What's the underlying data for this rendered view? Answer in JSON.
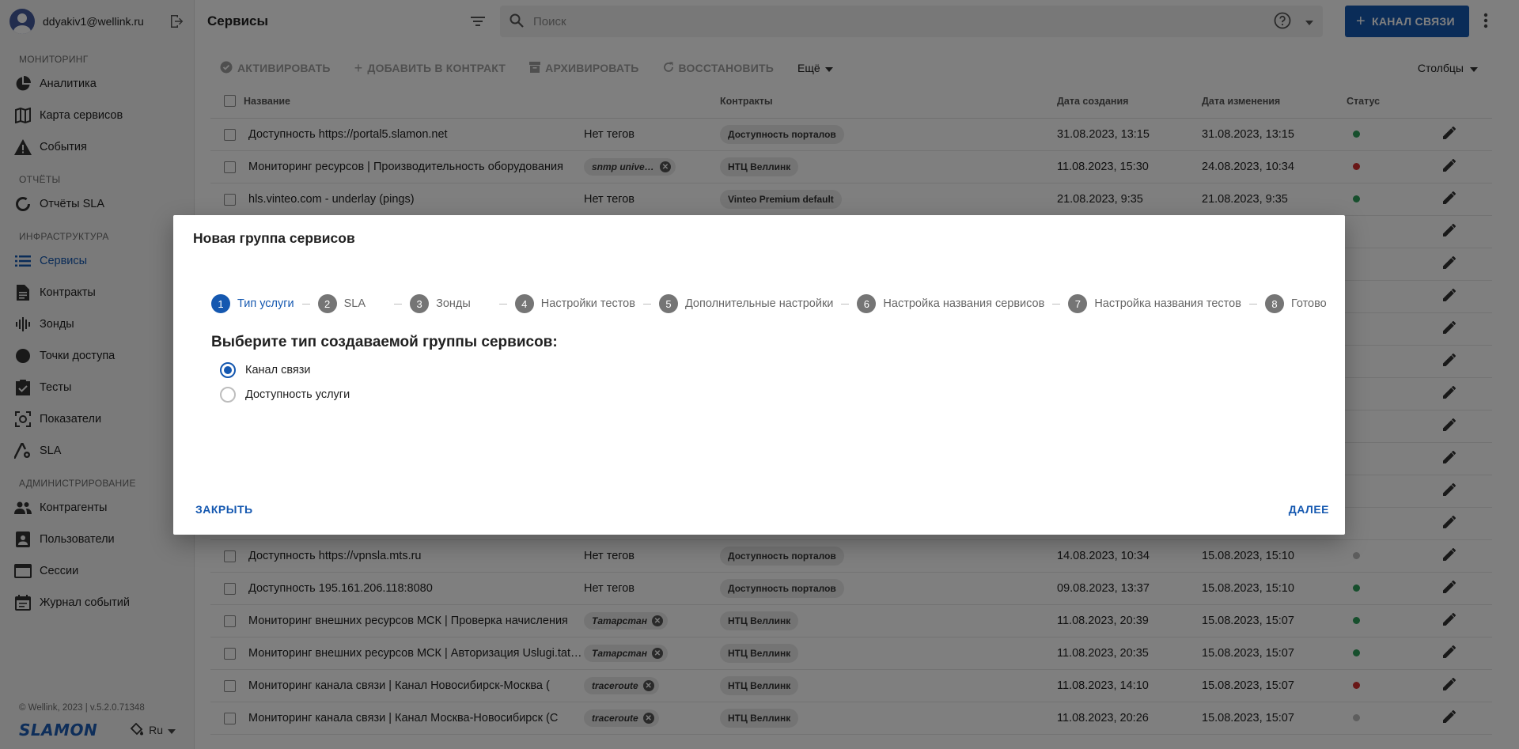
{
  "user": {
    "email": "ddyakiv1@wellink.ru"
  },
  "sidebar": {
    "sections": [
      {
        "title": "МОНИТОРИНГ",
        "items": [
          {
            "label": "Аналитика",
            "icon": "pie-chart-icon"
          },
          {
            "label": "Карта сервисов",
            "icon": "map-icon"
          },
          {
            "label": "События",
            "icon": "warning-icon"
          }
        ]
      },
      {
        "title": "ОТЧЁТЫ",
        "items": [
          {
            "label": "Отчёты SLA",
            "icon": "circle-report-icon"
          }
        ]
      },
      {
        "title": "ИНФРАСТРУКТУРА",
        "items": [
          {
            "label": "Сервисы",
            "icon": "list-icon"
          },
          {
            "label": "Контракты",
            "icon": "document-icon"
          },
          {
            "label": "Зонды",
            "icon": "probe-icon"
          },
          {
            "label": "Точки доступа",
            "icon": "dot-icon"
          },
          {
            "label": "Тесты",
            "icon": "checkbox-icon"
          },
          {
            "label": "Показатели",
            "icon": "metric-icon"
          },
          {
            "label": "SLA",
            "icon": "sla-icon"
          }
        ]
      },
      {
        "title": "АДМИНИСТРИРОВАНИЕ",
        "items": [
          {
            "label": "Контрагенты",
            "icon": "people-icon"
          },
          {
            "label": "Пользователи",
            "icon": "user-card-icon"
          },
          {
            "label": "Сессии",
            "icon": "window-icon"
          },
          {
            "label": "Журнал событий",
            "icon": "calendar-icon"
          }
        ]
      }
    ],
    "version": "© Wellink, 2023 | v.5.2.0.71348",
    "logo": "SLAMON",
    "language": "Ru"
  },
  "header": {
    "title": "Сервисы",
    "search_placeholder": "Поиск",
    "primary_button": "КАНАЛ СВЯЗИ"
  },
  "toolbar": {
    "activate": "АКТИВИРОВАТЬ",
    "add_to_contract": "ДОБАВИТЬ В КОНТРАКТ",
    "archive": "АРХИВИРОВАТЬ",
    "restore": "ВОССТАНОВИТЬ",
    "more": "Ещё",
    "columns": "Столбцы"
  },
  "table": {
    "headers": {
      "name": "Название",
      "contracts": "Контракты",
      "created": "Дата создания",
      "modified": "Дата изменения",
      "status": "Статус"
    },
    "rows": [
      {
        "name": "Доступность https://portal5.slamon.net",
        "tags": "Нет тегов",
        "tag_chip": null,
        "contract": "Доступность порталов",
        "created": "31.08.2023, 13:15",
        "modified": "31.08.2023, 13:15",
        "status_color": "#2e9e5b"
      },
      {
        "name": "Мониторинг ресурсов | Производительность оборудования",
        "tags": null,
        "tag_chip": "snmp universal",
        "contract": "НТЦ Веллинк",
        "created": "11.08.2023, 15:30",
        "modified": "24.08.2023, 10:34",
        "status_color": "#d32f2f"
      },
      {
        "name": "hls.vinteo.com - underlay (pings)",
        "tags": "Нет тегов",
        "tag_chip": null,
        "contract": "Vinteo Premium default",
        "created": "21.08.2023, 9:35",
        "modified": "21.08.2023, 9:35",
        "status_color": "#2e9e5b"
      },
      {
        "name": "",
        "tags": null,
        "tag_chip": null,
        "contract": "",
        "created": "",
        "modified": "",
        "status_color": ""
      },
      {
        "name": "",
        "tags": null,
        "tag_chip": null,
        "contract": "",
        "created": "",
        "modified": "",
        "status_color": ""
      },
      {
        "name": "",
        "tags": null,
        "tag_chip": null,
        "contract": "",
        "created": "",
        "modified": "",
        "status_color": ""
      },
      {
        "name": "",
        "tags": null,
        "tag_chip": null,
        "contract": "",
        "created": "",
        "modified": "",
        "status_color": ""
      },
      {
        "name": "",
        "tags": null,
        "tag_chip": null,
        "contract": "",
        "created": "",
        "modified": "",
        "status_color": ""
      },
      {
        "name": "",
        "tags": null,
        "tag_chip": null,
        "contract": "",
        "created": "",
        "modified": "",
        "status_color": ""
      },
      {
        "name": "",
        "tags": null,
        "tag_chip": null,
        "contract": "",
        "created": "",
        "modified": "",
        "status_color": ""
      },
      {
        "name": "",
        "tags": null,
        "tag_chip": null,
        "contract": "",
        "created": "",
        "modified": "",
        "status_color": ""
      },
      {
        "name": "",
        "tags": null,
        "tag_chip": null,
        "contract": "",
        "created": "",
        "modified": "",
        "status_color": ""
      },
      {
        "name": "",
        "tags": null,
        "tag_chip": null,
        "contract": "",
        "created": "",
        "modified": "",
        "status_color": ""
      },
      {
        "name": "Доступность https://vpnsla.mts.ru",
        "tags": "Нет тегов",
        "tag_chip": null,
        "contract": "Доступность порталов",
        "created": "14.08.2023, 10:34",
        "modified": "15.08.2023, 15:10",
        "status_color": "#bdbdbd"
      },
      {
        "name": "Доступность 195.161.206.118:8080",
        "tags": "Нет тегов",
        "tag_chip": null,
        "contract": "Доступность порталов",
        "created": "09.08.2023, 13:37",
        "modified": "15.08.2023, 15:10",
        "status_color": "#2e9e5b"
      },
      {
        "name": "Мониторинг внешних ресурсов МСК | Проверка начисления",
        "tags": null,
        "tag_chip": "Татарстан",
        "contract": "НТЦ Веллинк",
        "created": "11.08.2023, 20:39",
        "modified": "15.08.2023, 15:07",
        "status_color": "#2e9e5b"
      },
      {
        "name": "Мониторинг внешних ресурсов МСК | Авторизация Uslugi.tatarstan",
        "tags": null,
        "tag_chip": "Татарстан",
        "contract": "НТЦ Веллинк",
        "created": "11.08.2023, 20:35",
        "modified": "15.08.2023, 15:07",
        "status_color": "#2e9e5b"
      },
      {
        "name": "Мониторинг канала связи | Канал Новосибирск-Москва (",
        "tags": null,
        "tag_chip": "traceroute",
        "contract": "НТЦ Веллинк",
        "created": "11.08.2023, 14:10",
        "modified": "15.08.2023, 15:07",
        "status_color": "#d32f2f"
      },
      {
        "name": "Мониторинг канала связи | Канал Москва-Новосибирск (С",
        "tags": null,
        "tag_chip": "traceroute",
        "contract": "НТЦ Веллинк",
        "created": "11.08.2023, 20:26",
        "modified": "15.08.2023, 15:07",
        "status_color": "#bdbdbd"
      }
    ]
  },
  "modal": {
    "title": "Новая группа сервисов",
    "steps": [
      {
        "num": "1",
        "label": "Тип услуги",
        "active": true
      },
      {
        "num": "2",
        "label": "SLA"
      },
      {
        "num": "3",
        "label": "Зонды"
      },
      {
        "num": "4",
        "label": "Настройки тестов"
      },
      {
        "num": "5",
        "label": "Дополнительные настройки"
      },
      {
        "num": "6",
        "label": "Настройка названия сервисов"
      },
      {
        "num": "7",
        "label": "Настройка названия тестов"
      },
      {
        "num": "8",
        "label": "Готово"
      }
    ],
    "question": "Выберите тип создаваемой группы сервисов:",
    "options": [
      {
        "label": "Канал связи",
        "checked": true
      },
      {
        "label": "Доступность услуги",
        "checked": false
      }
    ],
    "close": "ЗАКРЫТЬ",
    "next": "ДАЛЕЕ"
  }
}
